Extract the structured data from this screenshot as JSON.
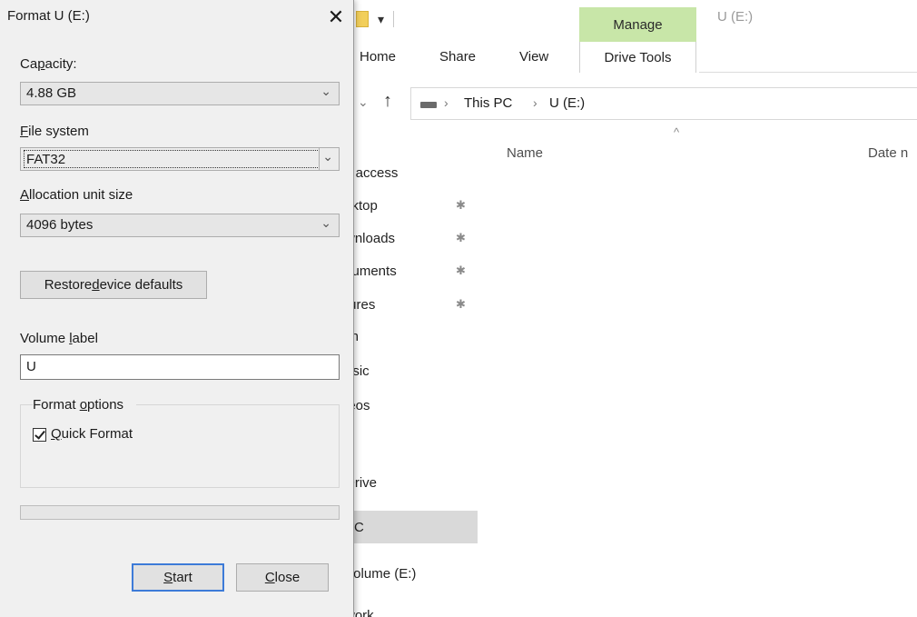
{
  "explorer": {
    "title": "U (E:)",
    "manage_tab": "Manage",
    "ribbon_tabs": [
      "Home",
      "Share",
      "View"
    ],
    "drive_tools_tab": "Drive Tools",
    "breadcrumb": [
      "This PC",
      "U (E:)"
    ],
    "column_name": "Name",
    "column_date": "Date n",
    "nav_items": [
      "k access",
      "sktop",
      "wnloads",
      "cuments",
      "tures",
      "lin",
      "usic",
      "leos",
      "Drive",
      "PC",
      "Volume (E:)",
      "work"
    ],
    "accent_colors": {
      "manage_tab_bg": "#c8e6a8",
      "selected_nav_bg": "#d9d9d9"
    }
  },
  "dialog": {
    "title": "Format U (E:)",
    "close_glyph": "✕",
    "capacity": {
      "label_pre": "Ca",
      "label_ul": "p",
      "label_post": "acity:",
      "value": "4.88 GB"
    },
    "file_system": {
      "label_pre": "",
      "label_ul": "F",
      "label_post": "ile system",
      "value": "FAT32"
    },
    "allocation": {
      "label_pre": "",
      "label_ul": "A",
      "label_post": "llocation unit size",
      "value": "4096 bytes"
    },
    "restore_button": {
      "pre": "Restore ",
      "ul": "d",
      "post": "evice defaults"
    },
    "volume_label": {
      "label_pre": "Volume ",
      "label_ul": "l",
      "label_post": "abel",
      "value": "U"
    },
    "format_options": {
      "title_pre": "Format ",
      "title_ul": "o",
      "title_post": "ptions"
    },
    "quick_format": {
      "checked": true,
      "label_ul": "Q",
      "label_post": "uick Format"
    },
    "progress": 0,
    "start_button": {
      "ul": "S",
      "post": "tart"
    },
    "close_button": {
      "ul": "C",
      "post": "lose"
    }
  }
}
